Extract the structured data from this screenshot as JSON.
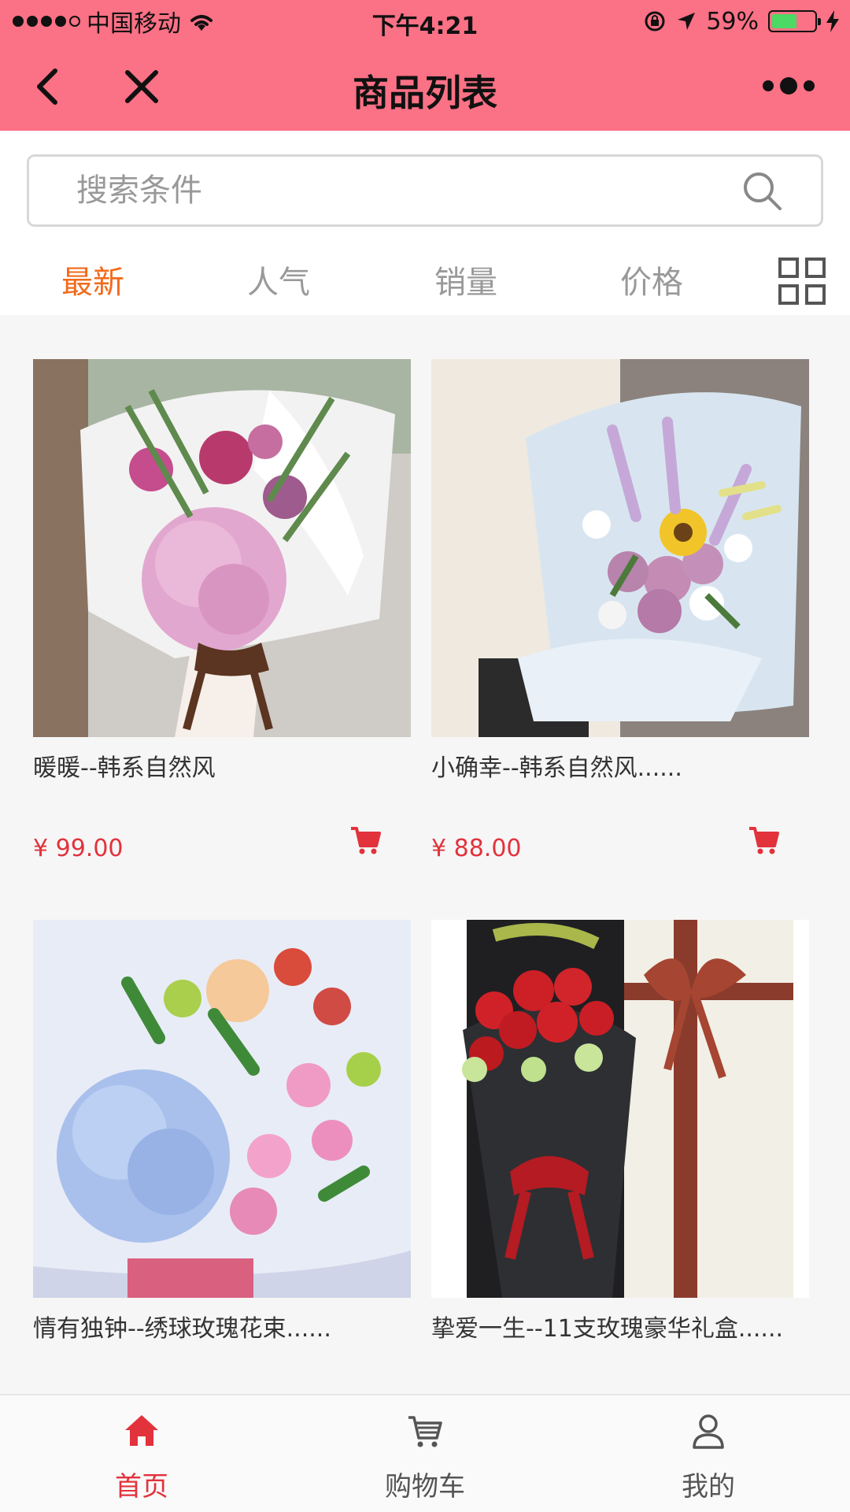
{
  "status_bar": {
    "carrier": "中国移动",
    "time": "下午4:21",
    "battery_text": "59%",
    "battery_level": 0.59,
    "battery_color": "#4cd964"
  },
  "nav": {
    "title": "商品列表",
    "back_icon": "chevron-left-icon",
    "close_icon": "close-icon",
    "more_icon": "more-dots-icon",
    "bg_color": "#fb7185"
  },
  "search": {
    "placeholder": "搜索条件",
    "value": ""
  },
  "sort_tabs": [
    {
      "label": "最新",
      "active": true
    },
    {
      "label": "人气",
      "active": false
    },
    {
      "label": "销量",
      "active": false
    },
    {
      "label": "价格",
      "active": false
    }
  ],
  "accent_color": "#f26a1b",
  "price_color": "#e2323c",
  "products": [
    {
      "name": "暖暖--韩系自然风",
      "price": "¥ 99.00"
    },
    {
      "name": "小确幸--韩系自然风......",
      "price": "¥ 88.00"
    },
    {
      "name": "情有独钟--绣球玫瑰花束......",
      "price": ""
    },
    {
      "name": "挚爱一生--11支玫瑰豪华礼盒......",
      "price": ""
    }
  ],
  "tabbar": [
    {
      "label": "首页",
      "icon": "home-icon",
      "active": true
    },
    {
      "label": "购物车",
      "icon": "cart-icon",
      "active": false
    },
    {
      "label": "我的",
      "icon": "user-icon",
      "active": false
    }
  ]
}
